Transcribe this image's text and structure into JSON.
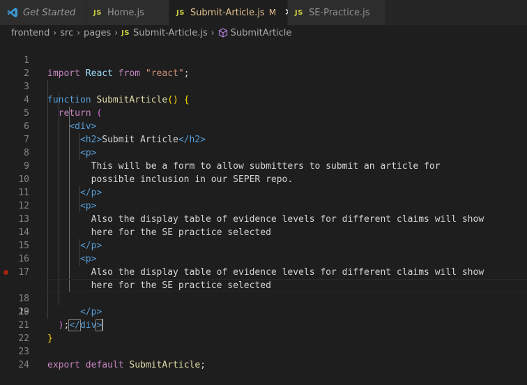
{
  "tabs": [
    {
      "label": "Get Started",
      "icon": "vscode-icon",
      "active": false
    },
    {
      "label": "Home.js",
      "icon": "js-icon",
      "icon_text": "JS",
      "active": false
    },
    {
      "label": "Submit-Article.js",
      "icon": "js-icon",
      "icon_text": "JS",
      "active": true,
      "status": "M"
    },
    {
      "label": "SE-Practice.js",
      "icon": "js-icon",
      "icon_text": "JS",
      "active": false
    }
  ],
  "breadcrumb": {
    "items": [
      "frontend",
      "src",
      "pages",
      "Submit-Article.js",
      "SubmitArticle"
    ],
    "js_icon_text": "JS"
  },
  "editor": {
    "line_numbers": [
      "1",
      "2",
      "3",
      "4",
      "5",
      "6",
      "7",
      "8",
      "9",
      "10",
      "11",
      "12",
      "13",
      "14",
      "15",
      "16",
      "17",
      "18",
      "19",
      "20",
      "21",
      "22",
      "23",
      "24"
    ],
    "current_line": 19,
    "breakpoint_line": 18,
    "tokens": {
      "import": "import",
      "react_id": "React",
      "from": "from",
      "react_str": "\"react\"",
      "semi": ";",
      "function": "function",
      "fn_name": "SubmitArticle",
      "fn_parens": "()",
      "open_brace": "{",
      "return": "return",
      "open_paren": "(",
      "div_open": "<div>",
      "h2_open": "<h2>",
      "h2_text": "Submit Article",
      "h2_close": "</h2>",
      "p_open": "<p>",
      "p_close": "</p>",
      "p1_line1": "This will be a form to allow submitters to submit an article for",
      "p1_line2": "possible inclusion in our SEPER repo.",
      "p2_line1": "Also the display table of evidence levels for different claims will show",
      "p2_line2": "here for the SE practice selected",
      "p3_line1": "Also the display table of evidence levels for different claims will show",
      "p3_line2": "here for the SE practice selected",
      "div_close_lt": "</",
      "div_close_name": "div",
      "div_close_gt": ">",
      "close_paren_semi": ");",
      "close_paren": ")",
      "close_brace": "}",
      "export": "export",
      "default": "default",
      "export_name": "SubmitArticle"
    }
  },
  "colors": {
    "keyword": "#c586c0",
    "function": "#dcdcaa",
    "variable": "#9cdcfe",
    "string": "#ce9178",
    "tag": "#569cd6",
    "modified": "#e2c08d",
    "js_badge": "#cbcb41",
    "breakpoint": "#a1260d",
    "editor_bg": "#1e1e1e"
  }
}
